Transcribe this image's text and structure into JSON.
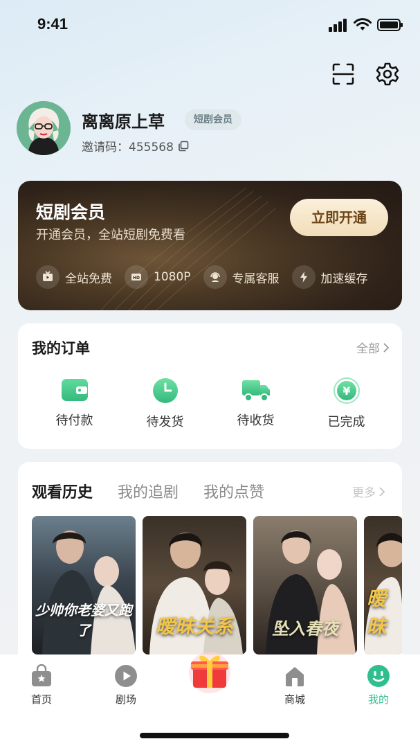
{
  "status_bar": {
    "time": "9:41"
  },
  "profile": {
    "username": "离离原上草",
    "member_tag": "短剧会员",
    "invite_code": "邀请码：455568"
  },
  "vip_card": {
    "title": "短剧会员",
    "subtitle": "开通会员，全站短剧免费看",
    "cta": "立即开通",
    "perks": [
      {
        "icon": "tv-icon",
        "label": "全站免费"
      },
      {
        "icon": "hd-icon",
        "label": "1080P"
      },
      {
        "icon": "headset-icon",
        "label": "专属客服"
      },
      {
        "icon": "lightning-icon",
        "label": "加速缓存"
      }
    ]
  },
  "orders": {
    "title": "我的订单",
    "all_link": "全部",
    "items": [
      {
        "icon": "wallet-icon",
        "label": "待付款"
      },
      {
        "icon": "clock-icon",
        "label": "待发货"
      },
      {
        "icon": "truck-icon",
        "label": "待收货"
      },
      {
        "icon": "yen-coin-icon",
        "label": "已完成"
      }
    ]
  },
  "history": {
    "tabs": [
      {
        "label": "观看历史",
        "active": true
      },
      {
        "label": "我的追剧",
        "active": false
      },
      {
        "label": "我的点赞",
        "active": false
      }
    ],
    "more_link": "更多",
    "posters": [
      {
        "title": "少帅你老婆又跑了"
      },
      {
        "title": "暧昧关系"
      },
      {
        "title": "坠入春夜"
      },
      {
        "title": "暧昧"
      }
    ]
  },
  "tabbar": {
    "items": [
      {
        "icon": "shopping-bag-icon",
        "label": "首页",
        "active": false
      },
      {
        "icon": "play-icon",
        "label": "剧场",
        "active": false
      },
      {
        "icon": "gift-icon",
        "label": "",
        "active": false
      },
      {
        "icon": "house-icon",
        "label": "商城",
        "active": false
      },
      {
        "icon": "smile-face-icon",
        "label": "我的",
        "active": true
      }
    ]
  },
  "colors": {
    "accent": "#2fbf8f",
    "vip_background": "#3a2a1e",
    "vip_button": "#f5e4c4"
  }
}
